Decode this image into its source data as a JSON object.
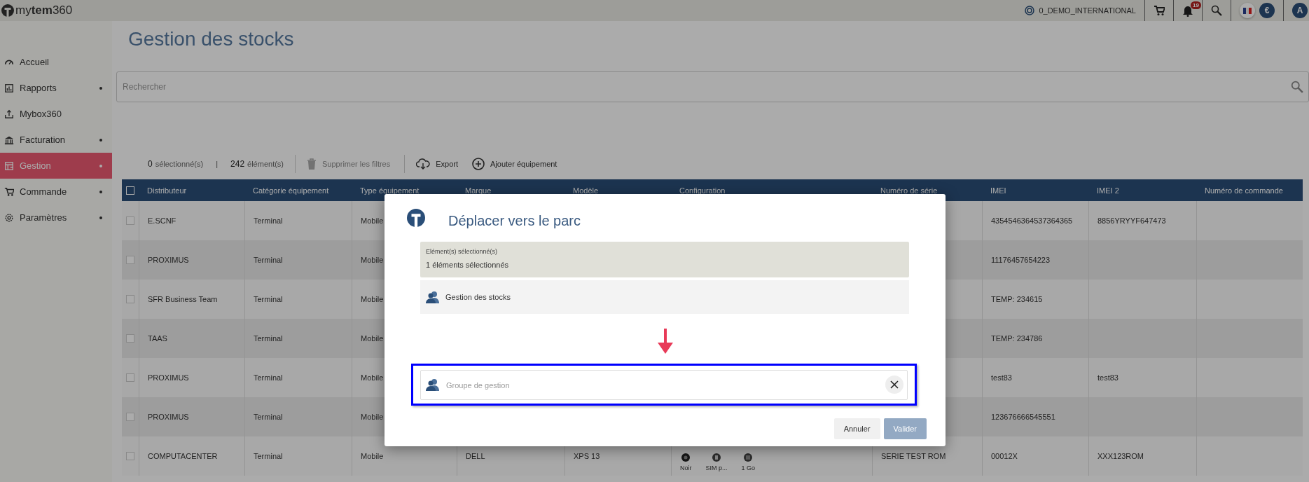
{
  "topbar": {
    "logo": "my**tem**360",
    "account": "0_DEMO_INTERNATIONAL",
    "notifications_badge": "19",
    "currency": "€",
    "avatar": "A"
  },
  "sidebar": {
    "items": [
      {
        "label": "Accueil",
        "has_submenu": false,
        "selected": false
      },
      {
        "label": "Rapports",
        "has_submenu": true,
        "selected": false
      },
      {
        "label": "Mybox360",
        "has_submenu": false,
        "selected": false
      },
      {
        "label": "Facturation",
        "has_submenu": true,
        "selected": false
      },
      {
        "label": "Gestion",
        "has_submenu": true,
        "selected": true
      },
      {
        "label": "Commande",
        "has_submenu": true,
        "selected": false
      },
      {
        "label": "Paramètres",
        "has_submenu": true,
        "selected": false
      }
    ]
  },
  "page_title": "Gestion des stocks",
  "search": {
    "placeholder": "Rechercher"
  },
  "toolbar": {
    "selected_count": "0",
    "selected_label": "sélectionné(s)",
    "separator": "|",
    "total_count": "242",
    "total_label": "élément(s)",
    "actions": [
      {
        "label": "Supprimer les filtres",
        "disabled": true
      },
      {
        "label": "Export",
        "disabled": false
      },
      {
        "label": "Ajouter équipement",
        "disabled": false
      }
    ]
  },
  "table": {
    "header_checked": false,
    "columns": [
      "Distributeur",
      "Catégorie équipement",
      "Type équipement",
      "Marque",
      "Modèle",
      "Configuration",
      "Numéro de série",
      "IMEI",
      "IMEI 2",
      "Numéro de commande"
    ],
    "rows": [
      {
        "checked": false,
        "cells": [
          "E.SCNF",
          "Terminal",
          "Mobile",
          null,
          null,
          null,
          null,
          "4354546364537364365",
          "8856YRYYF647473",
          null
        ]
      },
      {
        "checked": false,
        "cells": [
          "PROXIMUS",
          "Terminal",
          "Mobile",
          null,
          null,
          null,
          null,
          "11176457654223",
          null,
          null
        ]
      },
      {
        "checked": false,
        "cells": [
          "SFR Business Team",
          "Terminal",
          "Mobile",
          null,
          null,
          null,
          null,
          "TEMP: 234615",
          null,
          null
        ]
      },
      {
        "checked": false,
        "cells": [
          "TAAS",
          "Terminal",
          "Mobile",
          null,
          null,
          null,
          null,
          "TEMP: 234786",
          null,
          null
        ]
      },
      {
        "checked": false,
        "cells": [
          "PROXIMUS",
          "Terminal",
          "Mobile",
          null,
          null,
          null,
          null,
          "test83",
          "test83",
          null
        ]
      },
      {
        "checked": false,
        "cells": [
          "PROXIMUS",
          "Terminal",
          "Mobile",
          null,
          null,
          null,
          null,
          "123676666545551",
          null,
          null
        ]
      },
      {
        "checked": false,
        "cells": [
          "COMPUTACENTER",
          "Terminal",
          "Mobile",
          "DELL",
          "XPS 13",
          null,
          "SERIE TEST ROM",
          "00012X",
          "XXX123ROM",
          null
        ],
        "configuration": [
          {
            "kind": "color",
            "label": "Noir"
          },
          {
            "kind": "sim",
            "label": "SIM p..."
          },
          {
            "kind": "storage",
            "label": "1 Go"
          }
        ]
      }
    ]
  },
  "modal": {
    "title": "Déplacer vers le parc",
    "selection": {
      "label": "Elément(s) sélectionné(s)",
      "value": "1 éléments sélectionnés"
    },
    "source": "Gestion des stocks",
    "target": {
      "placeholder": "Groupe de gestion",
      "highlighted": true
    },
    "buttons": [
      {
        "label": "Annuler",
        "primary": false,
        "disabled": false
      },
      {
        "label": "Valider",
        "primary": true,
        "disabled": true
      }
    ]
  }
}
